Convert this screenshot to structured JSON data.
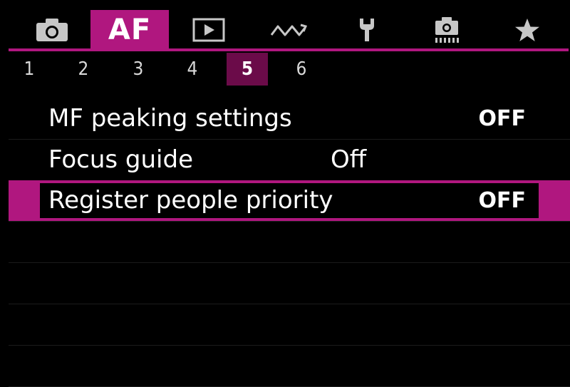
{
  "tabs": [
    {
      "id": "shooting",
      "icon": "camera-icon"
    },
    {
      "id": "af",
      "label": "AF",
      "active": true
    },
    {
      "id": "playback",
      "icon": "playback-icon"
    },
    {
      "id": "network",
      "icon": "wireless-icon"
    },
    {
      "id": "setup",
      "icon": "wrench-icon"
    },
    {
      "id": "custom",
      "icon": "custom-functions-icon"
    },
    {
      "id": "mymenu",
      "icon": "star-icon"
    }
  ],
  "pages": [
    "1",
    "2",
    "3",
    "4",
    "5",
    "6"
  ],
  "active_page": "5",
  "menu": {
    "items": [
      {
        "label": "MF peaking settings",
        "value": "OFF"
      },
      {
        "label": "Focus guide",
        "value": "Off"
      },
      {
        "label": "Register people priority",
        "value": "OFF",
        "selected": true
      }
    ]
  },
  "colors": {
    "accent": "#b0177f",
    "active_page_bg": "#6b0b49",
    "background": "#000000",
    "empty_row_bg": "#1b1b1b"
  }
}
